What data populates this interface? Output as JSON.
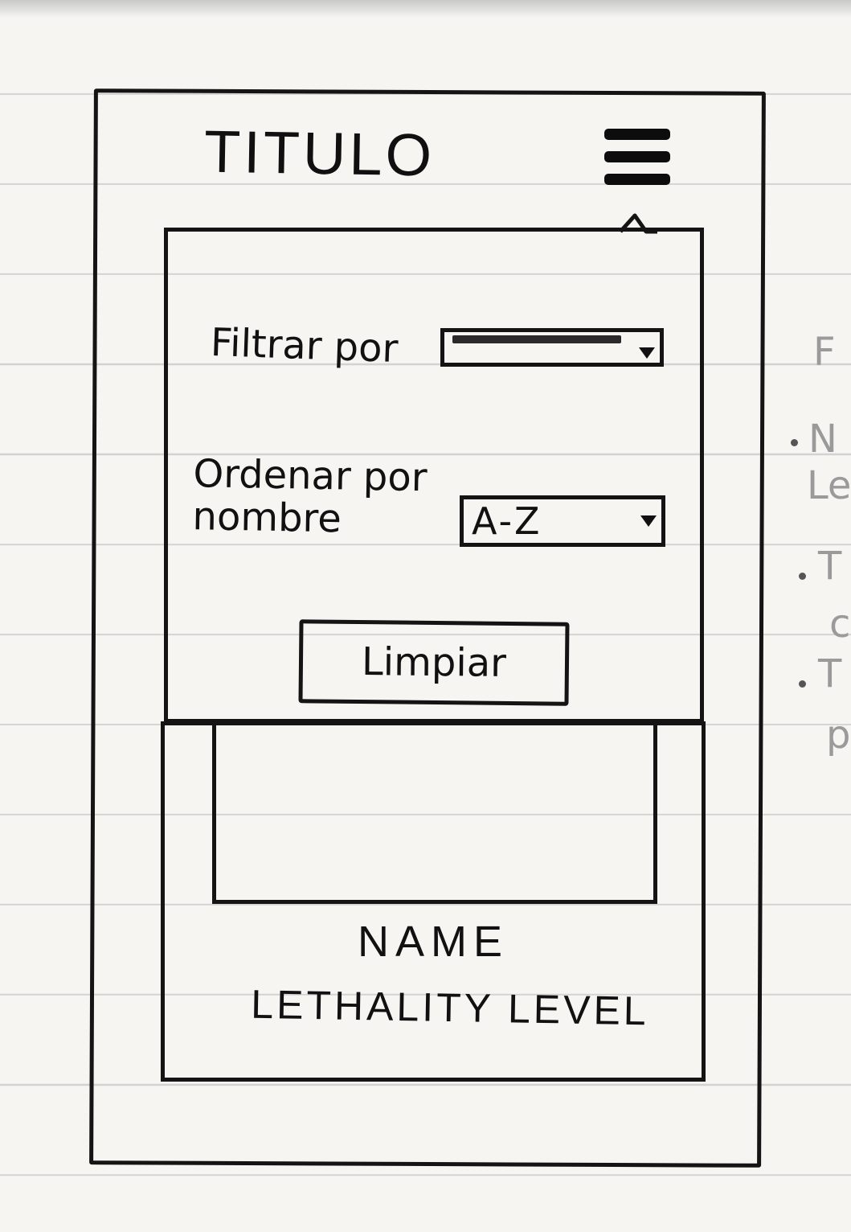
{
  "header": {
    "title": "TITULO",
    "menu_icon": "hamburger-menu-icon"
  },
  "filters": {
    "filter_label": "Filtrar por",
    "filter_value": "",
    "sort_label": "Ordenar por nombre",
    "sort_value": "A-Z",
    "dropdown_icon": "caret-down-icon",
    "clear_label": "Limpiar"
  },
  "card": {
    "name": "NAME",
    "lethality": "LETHALITY LEVEL"
  },
  "margin_notes": {
    "note_1": "F",
    "note_2": "N",
    "note_3": "Le",
    "note_4": "T",
    "note_5": "c",
    "note_6": "T",
    "note_7": "p"
  }
}
